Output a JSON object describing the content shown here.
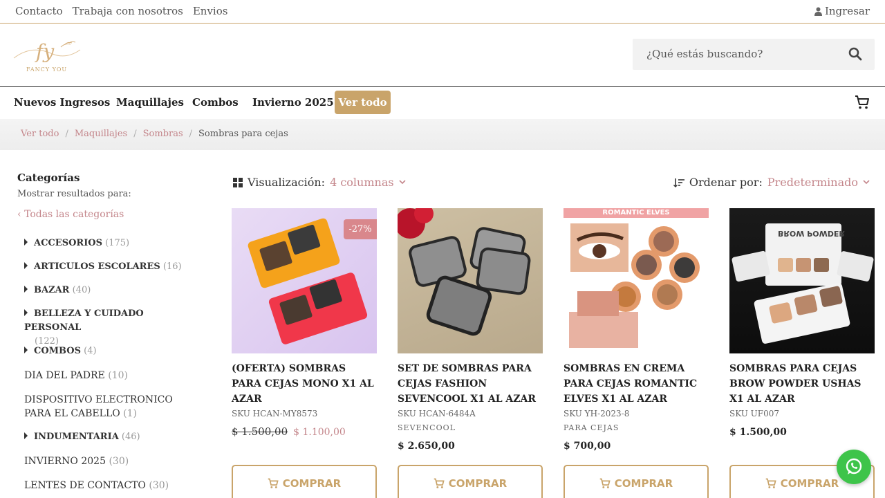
{
  "topbar": {
    "links": [
      "Contacto",
      "Trabaja con nosotros",
      "Envios"
    ],
    "login": "Ingresar"
  },
  "header": {
    "logo_script": "fy",
    "logo_text": "FANCY YOU",
    "search_placeholder": "¿Qué estás buscando?"
  },
  "nav": {
    "items": [
      "Nuevos Ingresos",
      "Maquillajes",
      "Combos",
      "Invierno 2025"
    ],
    "cta": "Ver todo"
  },
  "breadcrumb": {
    "links": [
      "Ver todo",
      "Maquillajes",
      "Sombras"
    ],
    "current": "Sombras para cejas"
  },
  "sidebar": {
    "title": "Categorías",
    "subtitle": "Mostrar resultados para:",
    "all_label": "Todas las categorías",
    "categories": [
      {
        "name": "ACCESORIOS",
        "count": "(175)",
        "expandable": true
      },
      {
        "name": "ARTICULOS ESCOLARES",
        "count": "(16)",
        "expandable": true
      },
      {
        "name": "BAZAR",
        "count": "(40)",
        "expandable": true
      },
      {
        "name": "BELLEZA Y CUIDADO PERSONAL",
        "count": "(122)",
        "expandable": true
      },
      {
        "name": "COMBOS",
        "count": "(4)",
        "expandable": true
      },
      {
        "name": "DIA DEL PADRE",
        "count": "(10)",
        "expandable": false
      },
      {
        "name": "DISPOSITIVO ELECTRONICO PARA EL CABELLO",
        "count": "(1)",
        "expandable": false
      },
      {
        "name": "INDUMENTARIA",
        "count": "(46)",
        "expandable": true
      },
      {
        "name": "INVIERNO 2025",
        "count": "(30)",
        "expandable": false
      },
      {
        "name": "LENTES DE CONTACTO",
        "count": "(30)",
        "expandable": false
      }
    ]
  },
  "toolbar": {
    "view_label": "Visualización:",
    "view_value": "4 columnas",
    "sort_label": "Ordenar por:",
    "sort_value": "Predeterminado"
  },
  "products": [
    {
      "name": "(OFERTA) SOMBRAS PARA CEJAS MONO X1 AL AZAR",
      "sku": "SKU HCAN-MY8573",
      "brand": "",
      "old_price": "$ 1.500,00",
      "price": "$ 1.100,00",
      "badge": "-27%"
    },
    {
      "name": "SET DE SOMBRAS PARA CEJAS FASHION SEVENCOOL X1 AL AZAR",
      "sku": "SKU HCAN-6484A",
      "brand": "SEVENCOOL",
      "old_price": "",
      "price": "$ 2.650,00",
      "badge": ""
    },
    {
      "name": "SOMBRAS EN CREMA PARA CEJAS ROMANTIC ELVES X1 AL AZAR",
      "sku": "SKU YH-2023-8",
      "brand": "PARA CEJAS",
      "old_price": "",
      "price": "$ 700,00",
      "badge": ""
    },
    {
      "name": "SOMBRAS PARA CEJAS BROW POWDER USHAS X1 AL AZAR",
      "sku": "SKU UF007",
      "brand": "",
      "old_price": "",
      "price": "$ 1.500,00",
      "badge": ""
    }
  ],
  "product_images": {
    "img3_banner": "ROMANTIC ELVES",
    "img4_label": "BROW POWDER"
  },
  "buy_label": "COMPRAR",
  "colors": {
    "accent": "#c9a46a",
    "pink": "#c4868b",
    "whatsapp": "#3ec44a"
  }
}
